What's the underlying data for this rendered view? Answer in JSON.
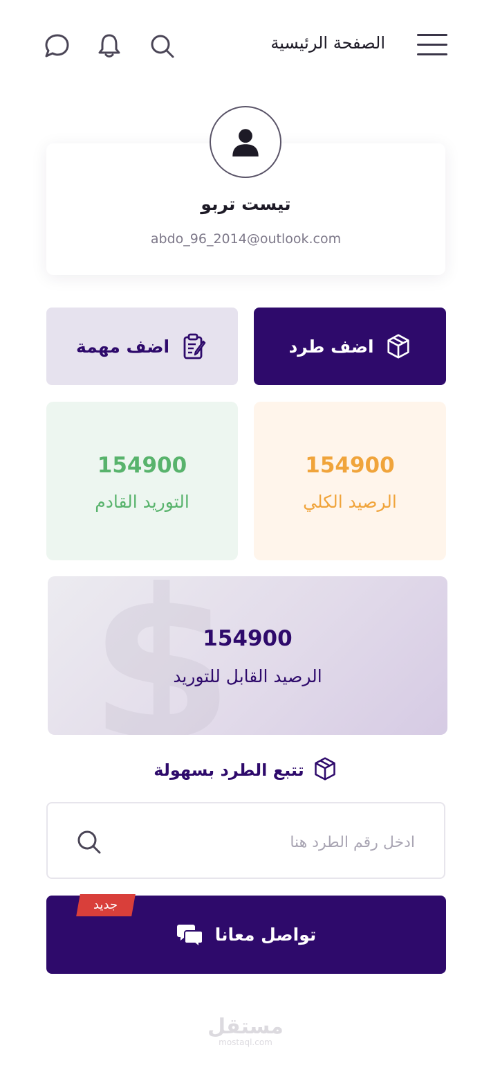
{
  "header": {
    "title": "الصفحة الرئيسية",
    "icons": [
      "menu-icon",
      "search-icon",
      "bell-icon",
      "chat-icon"
    ]
  },
  "profile": {
    "name": "تيست تربو",
    "email": "abdo_96_2014@outlook.com"
  },
  "actions": {
    "add_parcel": "اضف طرد",
    "add_task": "اضف مهمة"
  },
  "stats": {
    "total_balance": {
      "value": "154900",
      "label": "الرصيد الكلي",
      "color": "#f0a43b"
    },
    "upcoming_supply": {
      "value": "154900",
      "label": "التوريد القادم",
      "color": "#58b36c"
    },
    "available_balance": {
      "value": "154900",
      "label": "الرصيد القابل للتوريد",
      "color": "#2e0a6b"
    }
  },
  "tracking": {
    "title": "تتبع الطرد بسهولة",
    "placeholder": "ادخل رقم الطرد هنا",
    "value": ""
  },
  "contact": {
    "label": "تواصل معانا",
    "badge": "جديد"
  },
  "watermark": {
    "arabic": "مستقل",
    "latin": "mostaql.com"
  },
  "colors": {
    "primary": "#2e0a6b",
    "accent_red": "#d93f3a"
  }
}
